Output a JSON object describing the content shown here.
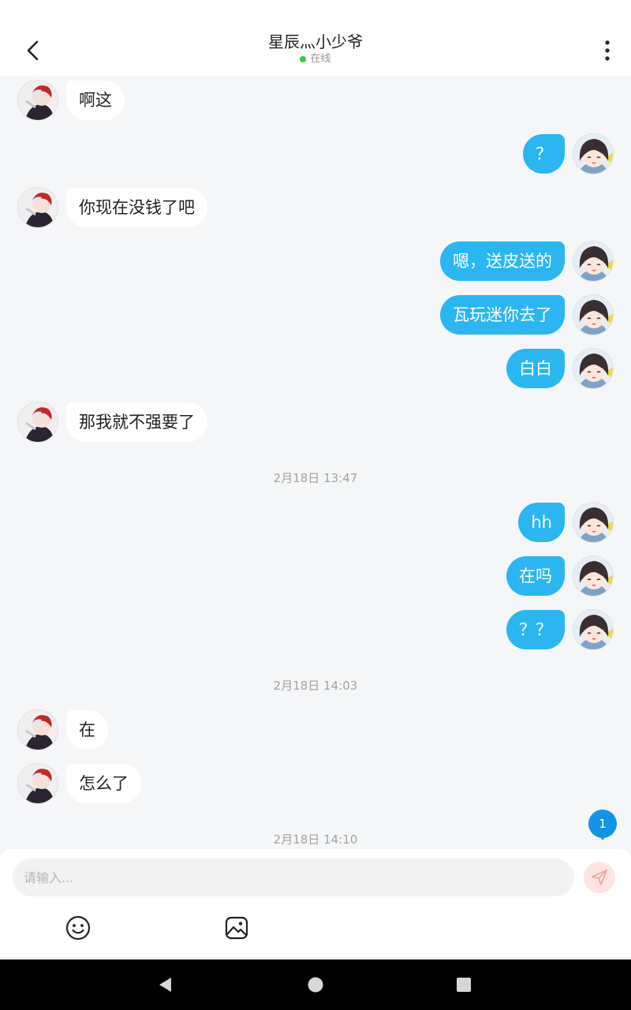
{
  "header": {
    "title": "星辰灬小少爷",
    "status": "在线",
    "status_color": "#2ecc40"
  },
  "icons": {
    "back": "chevron-left-icon",
    "more": "more-vertical-icon",
    "emoji": "emoji-icon",
    "image": "image-icon",
    "send": "send-icon"
  },
  "colors": {
    "outgoing_bubble": "#2bb6f2",
    "incoming_bubble": "#ffffff",
    "background": "#f4f6f8",
    "unread_badge": "#1493e8"
  },
  "messages": [
    {
      "side": "left",
      "text": "啊这"
    },
    {
      "side": "right",
      "text": "？"
    },
    {
      "side": "left",
      "text": "你现在没钱了吧"
    },
    {
      "side": "right",
      "text": "嗯，送皮送的"
    },
    {
      "side": "right",
      "text": "瓦玩迷你去了"
    },
    {
      "side": "right",
      "text": "白白"
    },
    {
      "side": "left",
      "text": "那我就不强要了"
    },
    {
      "side": "right",
      "text": "hh"
    },
    {
      "side": "right",
      "text": "在吗"
    },
    {
      "side": "right",
      "text": "？？"
    },
    {
      "side": "left",
      "text": "在"
    },
    {
      "side": "left",
      "text": "怎么了"
    }
  ],
  "timestamps": [
    "2月18日 13:47",
    "2月18日 14:03",
    "2月18日 14:10"
  ],
  "unread_count": "1",
  "composer": {
    "placeholder": "请输入...",
    "value": ""
  }
}
